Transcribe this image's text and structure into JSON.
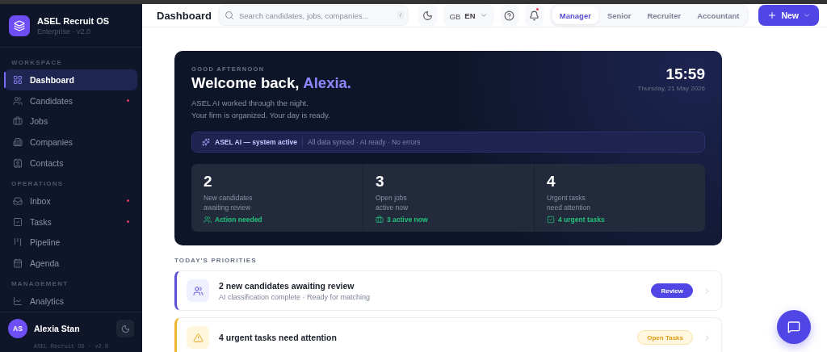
{
  "brand": {
    "name": "ASEL Recruit OS",
    "edition": "Enterprise · v2.0"
  },
  "sidebar": {
    "sections": [
      {
        "title": "WORKSPACE",
        "items": [
          {
            "label": "Dashboard",
            "selected": true,
            "badge": false
          },
          {
            "label": "Candidates",
            "selected": false,
            "badge": true
          },
          {
            "label": "Jobs",
            "selected": false,
            "badge": false
          },
          {
            "label": "Companies",
            "selected": false,
            "badge": false
          },
          {
            "label": "Contacts",
            "selected": false,
            "badge": false
          }
        ]
      },
      {
        "title": "OPERATIONS",
        "items": [
          {
            "label": "Inbox",
            "selected": false,
            "badge": true
          },
          {
            "label": "Tasks",
            "selected": false,
            "badge": true
          },
          {
            "label": "Pipeline",
            "selected": false,
            "badge": false
          },
          {
            "label": "Agenda",
            "selected": false,
            "badge": false
          }
        ]
      },
      {
        "title": "MANAGEMENT",
        "items": [
          {
            "label": "Analytics",
            "selected": false,
            "badge": false
          }
        ]
      }
    ]
  },
  "user": {
    "initials": "AS",
    "name": "Alexia Stan"
  },
  "footer_version": "ASEL Recruit OS · v2.0",
  "header": {
    "title": "Dashboard",
    "search_placeholder": "Search candidates, jobs, companies...",
    "search_shortcut": "/",
    "flag": "GB",
    "language": "EN",
    "notifications_unread": true,
    "roles": [
      {
        "label": "Manager",
        "selected": true
      },
      {
        "label": "Senior",
        "selected": false
      },
      {
        "label": "Recruiter",
        "selected": false
      },
      {
        "label": "Accountant",
        "selected": false
      }
    ],
    "new_button": "New"
  },
  "hero": {
    "greeting": "GOOD AFTERNOON",
    "welcome": "Welcome back,",
    "name": "Alexia.",
    "lines": [
      "ASEL AI worked through the night.",
      "Your firm is organized. Your day is ready."
    ],
    "time": "15:59",
    "date": "Thursday, 21 May 2026",
    "status": {
      "label": "ASEL AI — system active",
      "detail": "All data synced · AI ready · No errors"
    },
    "stats": [
      {
        "value": "2",
        "label_lines": [
          "New candidates",
          "awaiting review"
        ],
        "note": "Action needed"
      },
      {
        "value": "3",
        "label_lines": [
          "Open jobs",
          "active now"
        ],
        "note": "3 active now"
      },
      {
        "value": "4",
        "label_lines": [
          "Urgent tasks",
          "need attention"
        ],
        "note": "4 urgent tasks"
      }
    ]
  },
  "priorities": {
    "title": "TODAY'S PRIORITIES",
    "items": [
      {
        "kind": "info",
        "title": "2 new candidates awaiting review",
        "subtitle": "AI classification complete · Ready for matching",
        "action": "Review"
      },
      {
        "kind": "warning",
        "title": "4 urgent tasks need attention",
        "action": "Open Tasks"
      }
    ]
  }
}
